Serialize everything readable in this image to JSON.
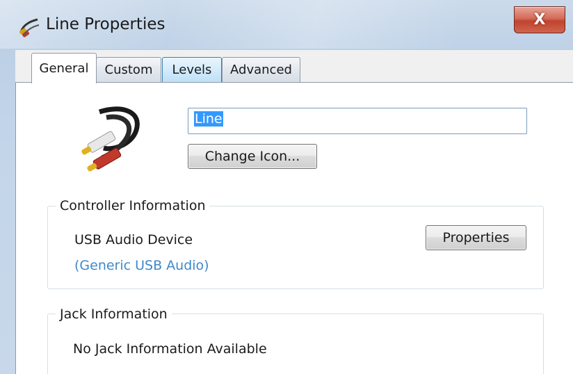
{
  "window": {
    "title": "Line Properties",
    "close_glyph": "X"
  },
  "tabs": [
    {
      "label": "General",
      "active": true
    },
    {
      "label": "Custom",
      "active": false
    },
    {
      "label": "Levels",
      "active": false,
      "hover": true
    },
    {
      "label": "Advanced",
      "active": false
    }
  ],
  "general": {
    "name_value": "Line",
    "change_icon_label": "Change Icon...",
    "device_icon": "rca-cable-icon"
  },
  "controller": {
    "group_label": "Controller Information",
    "device_name": "USB Audio Device",
    "driver_link": "(Generic USB Audio)",
    "properties_label": "Properties"
  },
  "jack": {
    "group_label": "Jack Information",
    "message": "No Jack Information Available"
  },
  "colors": {
    "link": "#3f88c9",
    "selection": "#3399ff",
    "close_button": "#c0442f"
  }
}
